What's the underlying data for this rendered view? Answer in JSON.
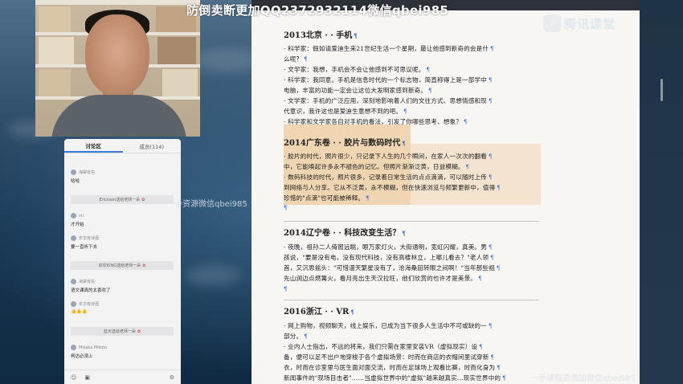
{
  "watermarks": {
    "top": "防倒卖断更加QQ2372932114微信qbei985",
    "middle": "一手资源微信qbei985",
    "bottom": "一手课程资源加微信qbei985"
  },
  "brand": {
    "name": "腾讯课堂"
  },
  "chat": {
    "tabs": [
      "讨论区",
      "成员(114)"
    ],
    "messages": [
      {
        "user": "海棠有信",
        "text": "哈哈"
      },
      {
        "system": "Ericsson送给老师一朵"
      },
      {
        "user": "nii",
        "text": "才开始"
      },
      {
        "user": "年华有诗酒",
        "text": "要一直听下去"
      },
      {
        "system": "欢欢KING送给老师一朵"
      },
      {
        "user": "海棠有信",
        "text": "语文课真的太喜欢了"
      },
      {
        "user": "年华有诗酒",
        "text": "👍👍👍"
      },
      {
        "system": "蓝天送给老师一朵"
      },
      {
        "user": "Misaka Mikoto",
        "text": "柯达必须上"
      }
    ],
    "gift_icon": "flower-icon"
  },
  "document": {
    "sections": [
      {
        "title": "2013北京 · · 手机",
        "lines": [
          "· 科学家：假如请爱迪生来21世纪生活一个星期，最让他感到新奇的会是什",
          "么呢？",
          "· 文学家：我想，手机会不会让他感到不可思议呢。",
          "· 科学家：我同意。手机是信息时代的一个标志物，简直称得上是一部学中",
          "电脑，丰富的功能一定会让这位大发明家感到新奇。",
          "· 文学家：手机的广泛应用，深刻地影响着人们的文往方式、思想情感和现",
          "代意识，我许这也是爱迪生意想不到的吧。",
          "· 科学家和文学家各自对手机的看法，引发了你哪些思考、想象？"
        ]
      },
      {
        "title": "2014广东卷 · · 胶片与数码时代",
        "lines": [
          "· 胶片的时代，照片很少，只记录下人生的几个瞬间，在家人一次次的翻看",
          "中，它能唤起许多永不褪色的记忆。但照片渐渐泛黄，日益模糊。",
          "· 数码科技的时代，照片很多，记录着日常生活的点点滴滴，可以随时上传",
          "到网络与人分享。它从不泛黄，永不模糊，但在快速浏览与频繁更新中，值得",
          "珍惜的\"点滴\"也可能被稀释。"
        ]
      },
      {
        "title": "2014辽宁卷 · · 科技改变生活？",
        "lines": [
          "· 夜晚，祖孙二人倚窗远眺，眼万家灯火，大街通明，宽虹闪耀，真美。男",
          "孩说，\"要是没有电，没有现代科技，没有高楼林立，上哪儿看去？\"老人领",
          "首，又沉思摇头：\"可惜漫天繁星没有了，沧海桑田转眼之间啊！\"当年那些祖",
          "先山涧边点燃篝火，看月亮出生天汉拉旺，他们欣赏的也许才是美景。"
        ]
      },
      {
        "title": "2016浙江 · · VR",
        "lines": [
          "· 网上购物，视频聊天，线上娱乐，已成为当下很多人生活中不可或缺的一",
          "部分。",
          "· 业内人士指出，不远的将来，我们只需在家里安装VR（虚拟现实）设",
          "备，便可以足不出户地穿梭于各个虚拟场景：时而在商店的衣帽间里试穿新",
          "衣，时而在诊室里与医生面对面交流，时而在足球场上观看比赛，时而化身为",
          "新闻事件的\"现场目击者\"……当虚拟世界中的\"虚拟\"越来越真实...现实世界中的"
        ]
      }
    ]
  }
}
